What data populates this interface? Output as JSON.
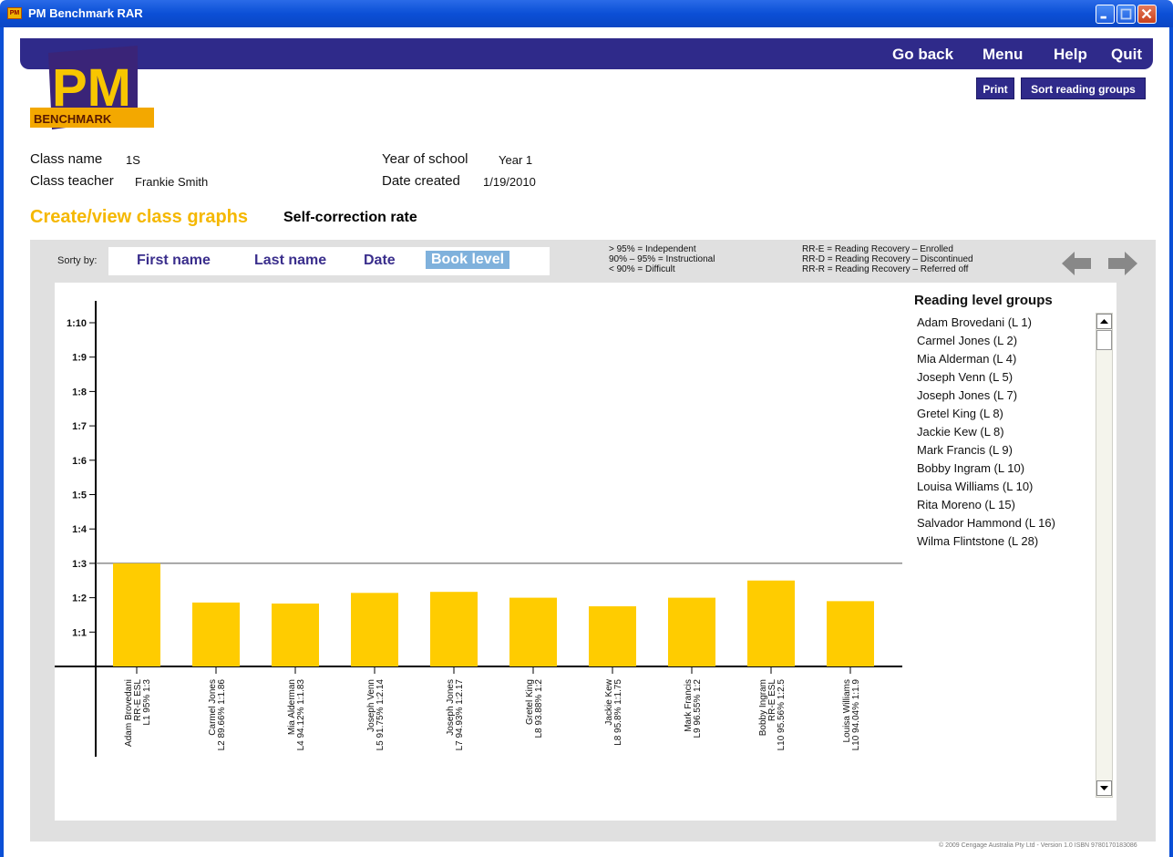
{
  "window": {
    "title": "PM Benchmark RAR",
    "app_icon_text": "PM"
  },
  "nav": {
    "go_back": "Go back",
    "menu": "Menu",
    "help": "Help",
    "quit": "Quit"
  },
  "logo": {
    "letters": "PM",
    "word": "BENCHMARK"
  },
  "actions": {
    "print": "Print",
    "sort_reading_groups": "Sort reading groups"
  },
  "class_info": {
    "class_name_label": "Class name",
    "class_name": "1S",
    "teacher_label": "Class teacher",
    "teacher": "Frankie Smith",
    "year_label": "Year of school",
    "year": "Year 1",
    "date_label": "Date created",
    "date": "1/19/2010"
  },
  "section": {
    "title": "Create/view class graphs",
    "subtitle": "Self-correction rate"
  },
  "sort": {
    "label": "Sorty by:",
    "options": [
      "First name",
      "Last name",
      "Date",
      "Book level"
    ],
    "active": "Book level"
  },
  "legend": {
    "levels": [
      "> 95% = Independent",
      "90% – 95% = Instructional",
      "< 90% = Difficult"
    ],
    "rr": [
      "RR-E = Reading Recovery – Enrolled",
      "RR-D = Reading Recovery – Discontinued",
      "RR-R = Reading Recovery – Referred off"
    ]
  },
  "groups": {
    "title": "Reading level groups",
    "items": [
      "Adam Brovedani (L 1)",
      "Carmel Jones (L 2)",
      "Mia Alderman (L 4)",
      "Joseph Venn (L 5)",
      "Joseph Jones (L 7)",
      "Gretel King (L 8)",
      "Jackie Kew (L 8)",
      "Mark Francis (L 9)",
      "Bobby Ingram (L 10)",
      "Louisa Williams (L 10)",
      "Rita Moreno (L 15)",
      "Salvador Hammond (L 16)",
      "Wilma Flintstone (L 28)"
    ]
  },
  "chart_data": {
    "type": "bar",
    "title": "Self-correction rate",
    "y_ticks": [
      "1:1",
      "1:2",
      "1:3",
      "1:4",
      "1:5",
      "1:6",
      "1:7",
      "1:8",
      "1:9",
      "1:10"
    ],
    "ylim": [
      0,
      10.5
    ],
    "reference_line": 3,
    "bar_color": "#ffcc00",
    "categories": [
      [
        "Adam Brovedani",
        "RR-E ESL",
        "L1 95% 1:3"
      ],
      [
        "Carmel Jones",
        "L2 89.66% 1:1.86"
      ],
      [
        "Mia Alderman",
        "L4 94.12% 1:1.83"
      ],
      [
        "Joseph Venn",
        "L5 91.75% 1:2.14"
      ],
      [
        "Joseph Jones",
        "L7 94.93% 1:2.17"
      ],
      [
        "Gretel King",
        "L8 93.88% 1:2"
      ],
      [
        "Jackie Kew",
        "L8 95.8% 1:1.75"
      ],
      [
        "Mark Francis",
        "L9 96.55% 1:2"
      ],
      [
        "Bobby Ingram",
        "RR-E ESL",
        "L10 95.56% 1:2.5"
      ],
      [
        "Louisa Williams",
        "L10 94.04% 1:1.9"
      ]
    ],
    "values": [
      3,
      1.86,
      1.83,
      2.14,
      2.17,
      2,
      1.75,
      2,
      2.5,
      1.9
    ]
  },
  "footer": {
    "copyright": "© 2009 Cengage Australia Pty Ltd - Version 1.0 ISBN 9780170183086"
  }
}
